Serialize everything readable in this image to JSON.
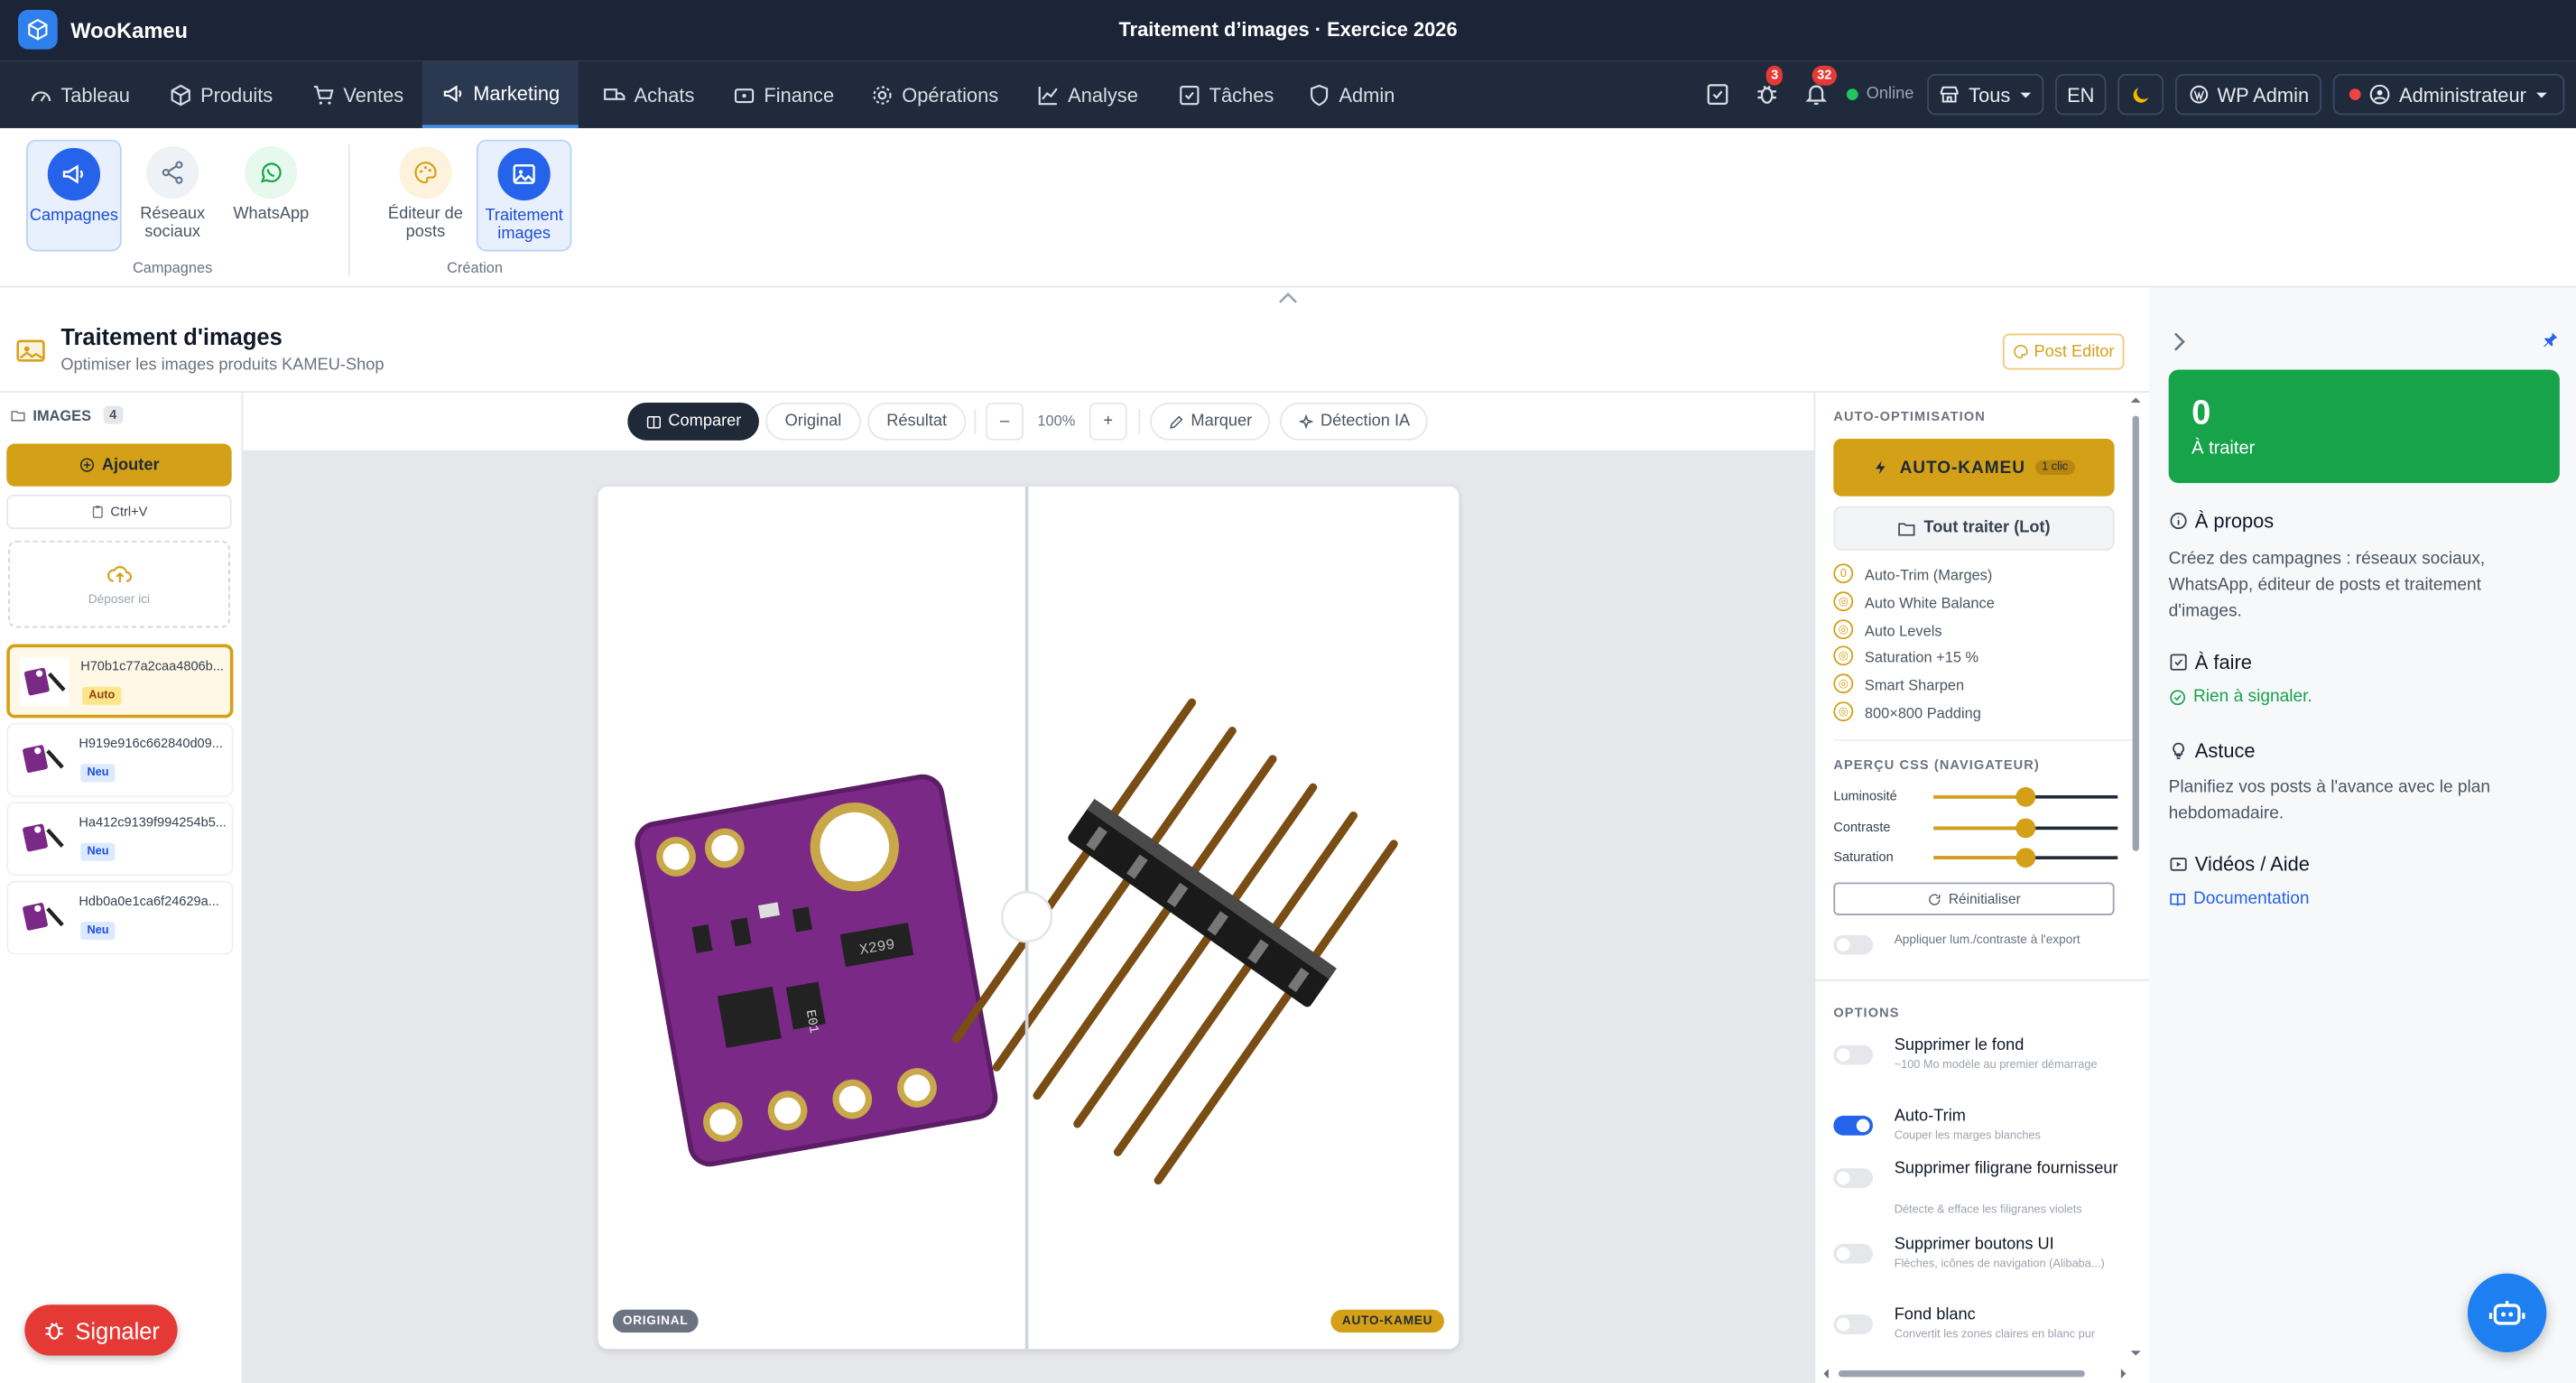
{
  "app": {
    "name": "WooKameu",
    "window_title": "Traitement d’images · Exercice 2026"
  },
  "nav": {
    "items": [
      {
        "label": "Tableau",
        "icon": "dashboard-icon"
      },
      {
        "label": "Produits",
        "icon": "box-icon"
      },
      {
        "label": "Ventes",
        "icon": "cart-icon"
      },
      {
        "label": "Marketing",
        "icon": "megaphone-icon",
        "active": true
      },
      {
        "label": "Achats",
        "icon": "truck-icon"
      },
      {
        "label": "Finance",
        "icon": "wallet-icon"
      },
      {
        "label": "Opérations",
        "icon": "gear-icon"
      },
      {
        "label": "Analyse",
        "icon": "chart-icon"
      },
      {
        "label": "Tâches",
        "icon": "checkbox-icon"
      },
      {
        "label": "Admin",
        "icon": "shield-icon"
      }
    ],
    "bug_count": "3",
    "notif_count": "32",
    "status": "Online",
    "store_filter": "Tous",
    "lang": "EN",
    "wp_admin": "WP Admin",
    "user": "Administrateur"
  },
  "ribbon": {
    "tiles": [
      {
        "label": "Campagnes",
        "icon": "megaphone-icon"
      },
      {
        "label": "Réseaux sociaux",
        "icon": "share-icon"
      },
      {
        "label": "WhatsApp",
        "icon": "whatsapp-icon"
      },
      {
        "label": "Éditeur de posts",
        "icon": "palette-icon"
      },
      {
        "label": "Traitement images",
        "icon": "image-icon"
      }
    ],
    "groups": [
      "Campagnes",
      "Création"
    ]
  },
  "page": {
    "title": "Traitement d'images",
    "subtitle": "Optimiser les images produits KAMEU-Shop",
    "post_editor": "Post Editor"
  },
  "images": {
    "header": "IMAGES",
    "count": "4",
    "add": "Ajouter",
    "paste": "Ctrl+V",
    "drop": "Déposer ici",
    "files": [
      {
        "name": "H70b1c77a2caa4806b...",
        "tag": "Auto",
        "selected": true
      },
      {
        "name": "H919e916c662840d09...",
        "tag": "Neu"
      },
      {
        "name": "Ha412c9139f994254b5...",
        "tag": "Neu"
      },
      {
        "name": "Hdb0a0e1ca6f24629a...",
        "tag": "Neu"
      }
    ]
  },
  "toolbar": {
    "compare": "Comparer",
    "original": "Original",
    "result": "Résultat",
    "minus": "–",
    "zoom": "100%",
    "plus": "+",
    "mark": "Marquer",
    "ai": "Détection IA"
  },
  "preview": {
    "left_label": "ORIGINAL",
    "right_label": "AUTO-KAMEU",
    "chip_text": "X299",
    "chip2_text": "E01"
  },
  "auto": {
    "section": "AUTO-OPTIMISATION",
    "button": "AUTO-KAMEU",
    "button_badge": "1 clic",
    "batch": "Tout traiter (Lot)",
    "steps": [
      {
        "n": "0",
        "label": "Auto-Trim (Marges)"
      },
      {
        "n": "◎",
        "label": "Auto White Balance"
      },
      {
        "n": "◎",
        "label": "Auto Levels"
      },
      {
        "n": "◎",
        "label": "Saturation +15 %"
      },
      {
        "n": "◎",
        "label": "Smart Sharpen"
      },
      {
        "n": "◎",
        "label": "800×800 Padding"
      }
    ]
  },
  "css_preview": {
    "section": "APERÇU CSS (NAVIGATEUR)",
    "sliders": [
      {
        "label": "Luminosité",
        "value": 0.5
      },
      {
        "label": "Contraste",
        "value": 0.5
      },
      {
        "label": "Saturation",
        "value": 0.5
      }
    ],
    "reset": "Réinitialiser",
    "apply_label": "Appliquer lum./contraste à l'export"
  },
  "options": {
    "section": "OPTIONS",
    "items": [
      {
        "title": "Supprimer le fond",
        "sub": "~100 Mo modèle au premier démarrage",
        "on": false
      },
      {
        "title": "Auto-Trim",
        "sub": "Couper les marges blanches",
        "on": true
      },
      {
        "title": "Supprimer filigrane fournisseur",
        "sub": "Détecte & efface les filigranes violets",
        "on": false
      },
      {
        "title": "Supprimer boutons UI",
        "sub": "Flèches, icônes de navigation (Alibaba...)",
        "on": false
      },
      {
        "title": "Fond blanc",
        "sub": "Convertit les zones claires en blanc pur",
        "on": false
      }
    ]
  },
  "sidebar": {
    "count": "0",
    "count_label": "À traiter",
    "about_title": "À propos",
    "about_text": "Créez des campagnes : réseaux sociaux, WhatsApp, éditeur de posts et traitement d'images.",
    "todo_title": "À faire",
    "todo_text": "Rien à signaler.",
    "tip_title": "Astuce",
    "tip_text": "Planifiez vos posts à l'avance avec le plan hebdomadaire.",
    "videos_title": "Vidéos / Aide",
    "doc_link": "Documentation"
  },
  "report": {
    "label": "Signaler"
  },
  "colors": {
    "accent": "#d4a017",
    "primary": "#2563eb",
    "topbar": "#1b2537",
    "success": "#16a34a"
  }
}
